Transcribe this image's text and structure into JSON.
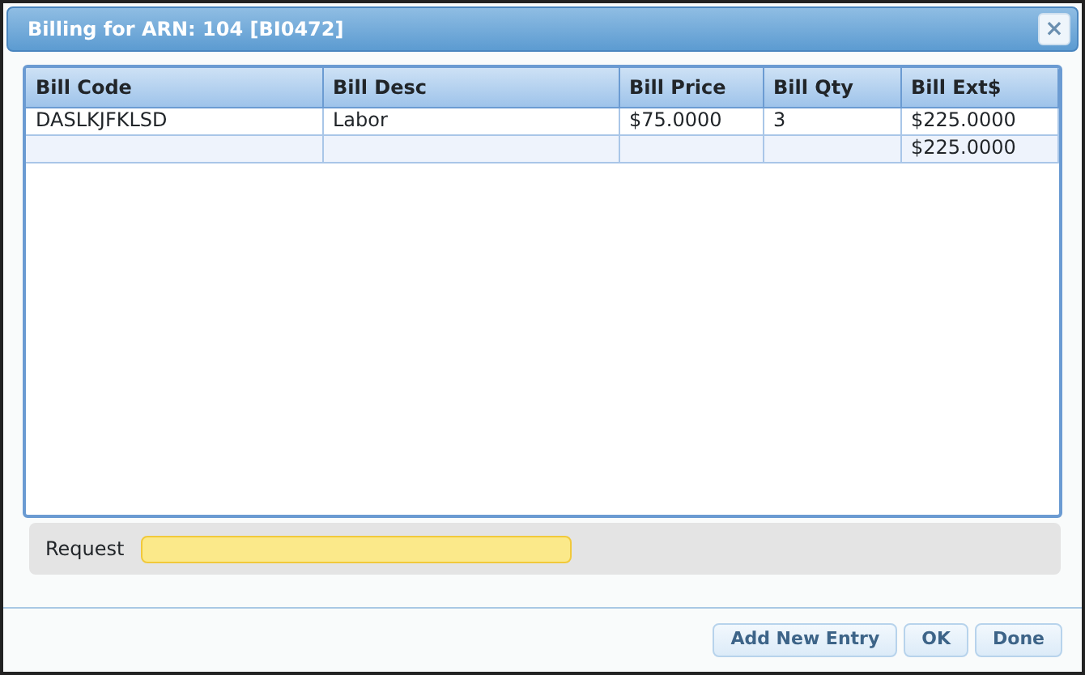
{
  "window": {
    "title": "Billing for ARN: 104 [BI0472]",
    "close": "×"
  },
  "table": {
    "columns": [
      "Bill Code",
      "Bill Desc",
      "Bill Price",
      "Bill Qty",
      "Bill Ext$"
    ],
    "rows": [
      [
        "DASLKJFKLSD",
        "Labor",
        "$75.0000",
        "3",
        "$225.0000"
      ]
    ],
    "total": "$225.0000"
  },
  "request": {
    "label": "Request"
  },
  "buttons": [
    "Add New Entry",
    "OK",
    "Done"
  ]
}
